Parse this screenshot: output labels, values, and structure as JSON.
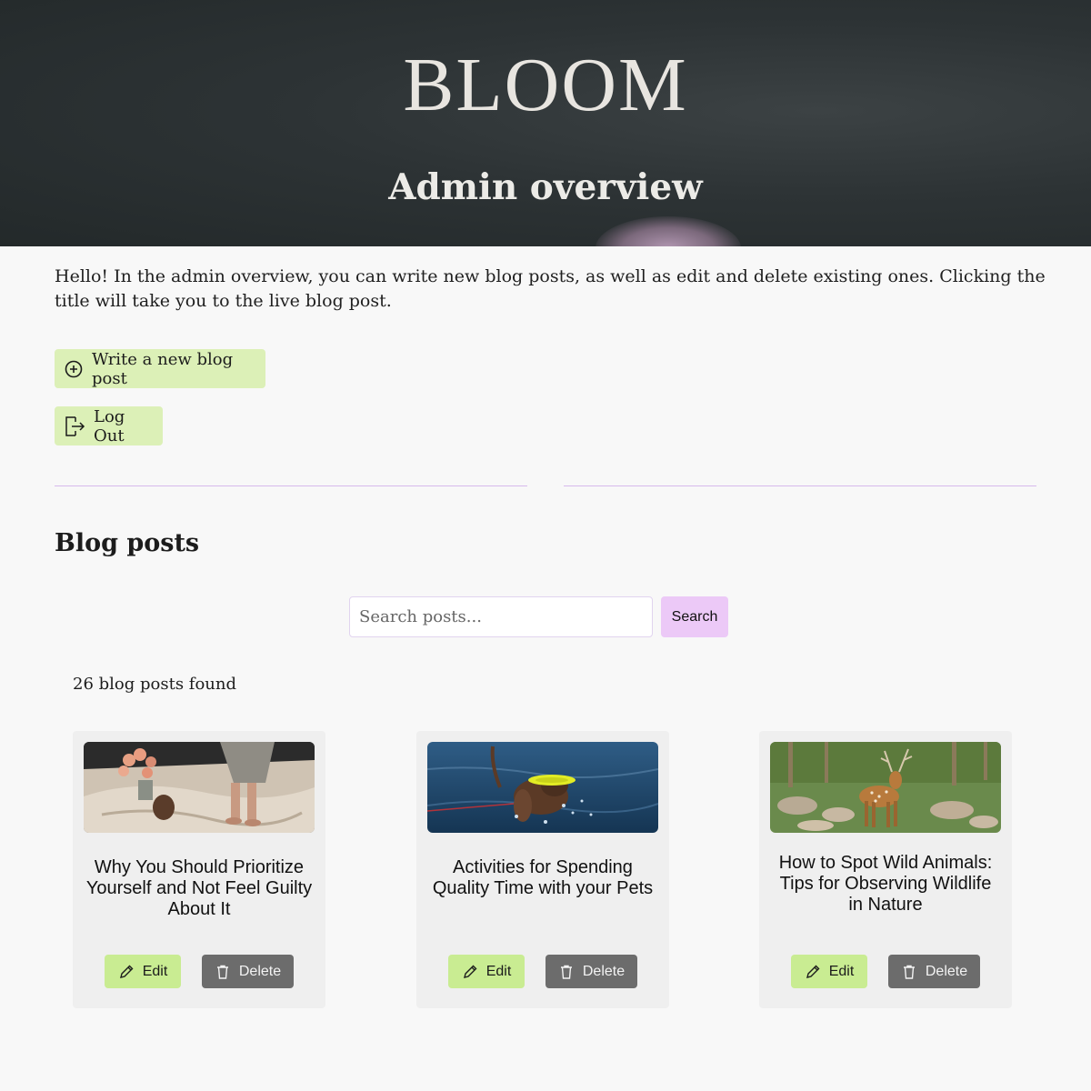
{
  "header": {
    "brand": "BLOOM",
    "subtitle": "Admin overview"
  },
  "intro": {
    "text": "Hello! In the admin overview, you can write new blog posts, as well as edit and delete existing ones. Clicking the title will take you to the live blog post."
  },
  "actions": {
    "write_label": "Write a new blog post",
    "write_icon": "plus-circle-icon",
    "logout_label": "Log Out",
    "logout_icon": "logout-icon"
  },
  "posts_section": {
    "title": "Blog posts",
    "search_placeholder": "Search posts...",
    "search_button": "Search",
    "count_text": "26 blog posts found"
  },
  "posts": [
    {
      "title": "Why You Should Prioritize Yourself and Not Feel Guilty About It",
      "image": "feet-on-blanket-with-flowers",
      "edit_label": "Edit",
      "delete_label": "Delete"
    },
    {
      "title": "Activities for Spending Quality Time with your Pets",
      "image": "dog-with-frisbee-in-water",
      "edit_label": "Edit",
      "delete_label": "Delete"
    },
    {
      "title": "How to Spot Wild Animals: Tips for Observing Wildlife in Nature",
      "image": "spotted-deer-in-forest",
      "edit_label": "Edit",
      "delete_label": "Delete"
    }
  ],
  "colors": {
    "accent_green": "#dcf0b7",
    "edit_green": "#c9ec92",
    "delete_gray": "#6c6c6c",
    "search_purple": "#ecc9f7",
    "divider_purple": "#d7b9ec",
    "header_dark": "#2d3335"
  }
}
